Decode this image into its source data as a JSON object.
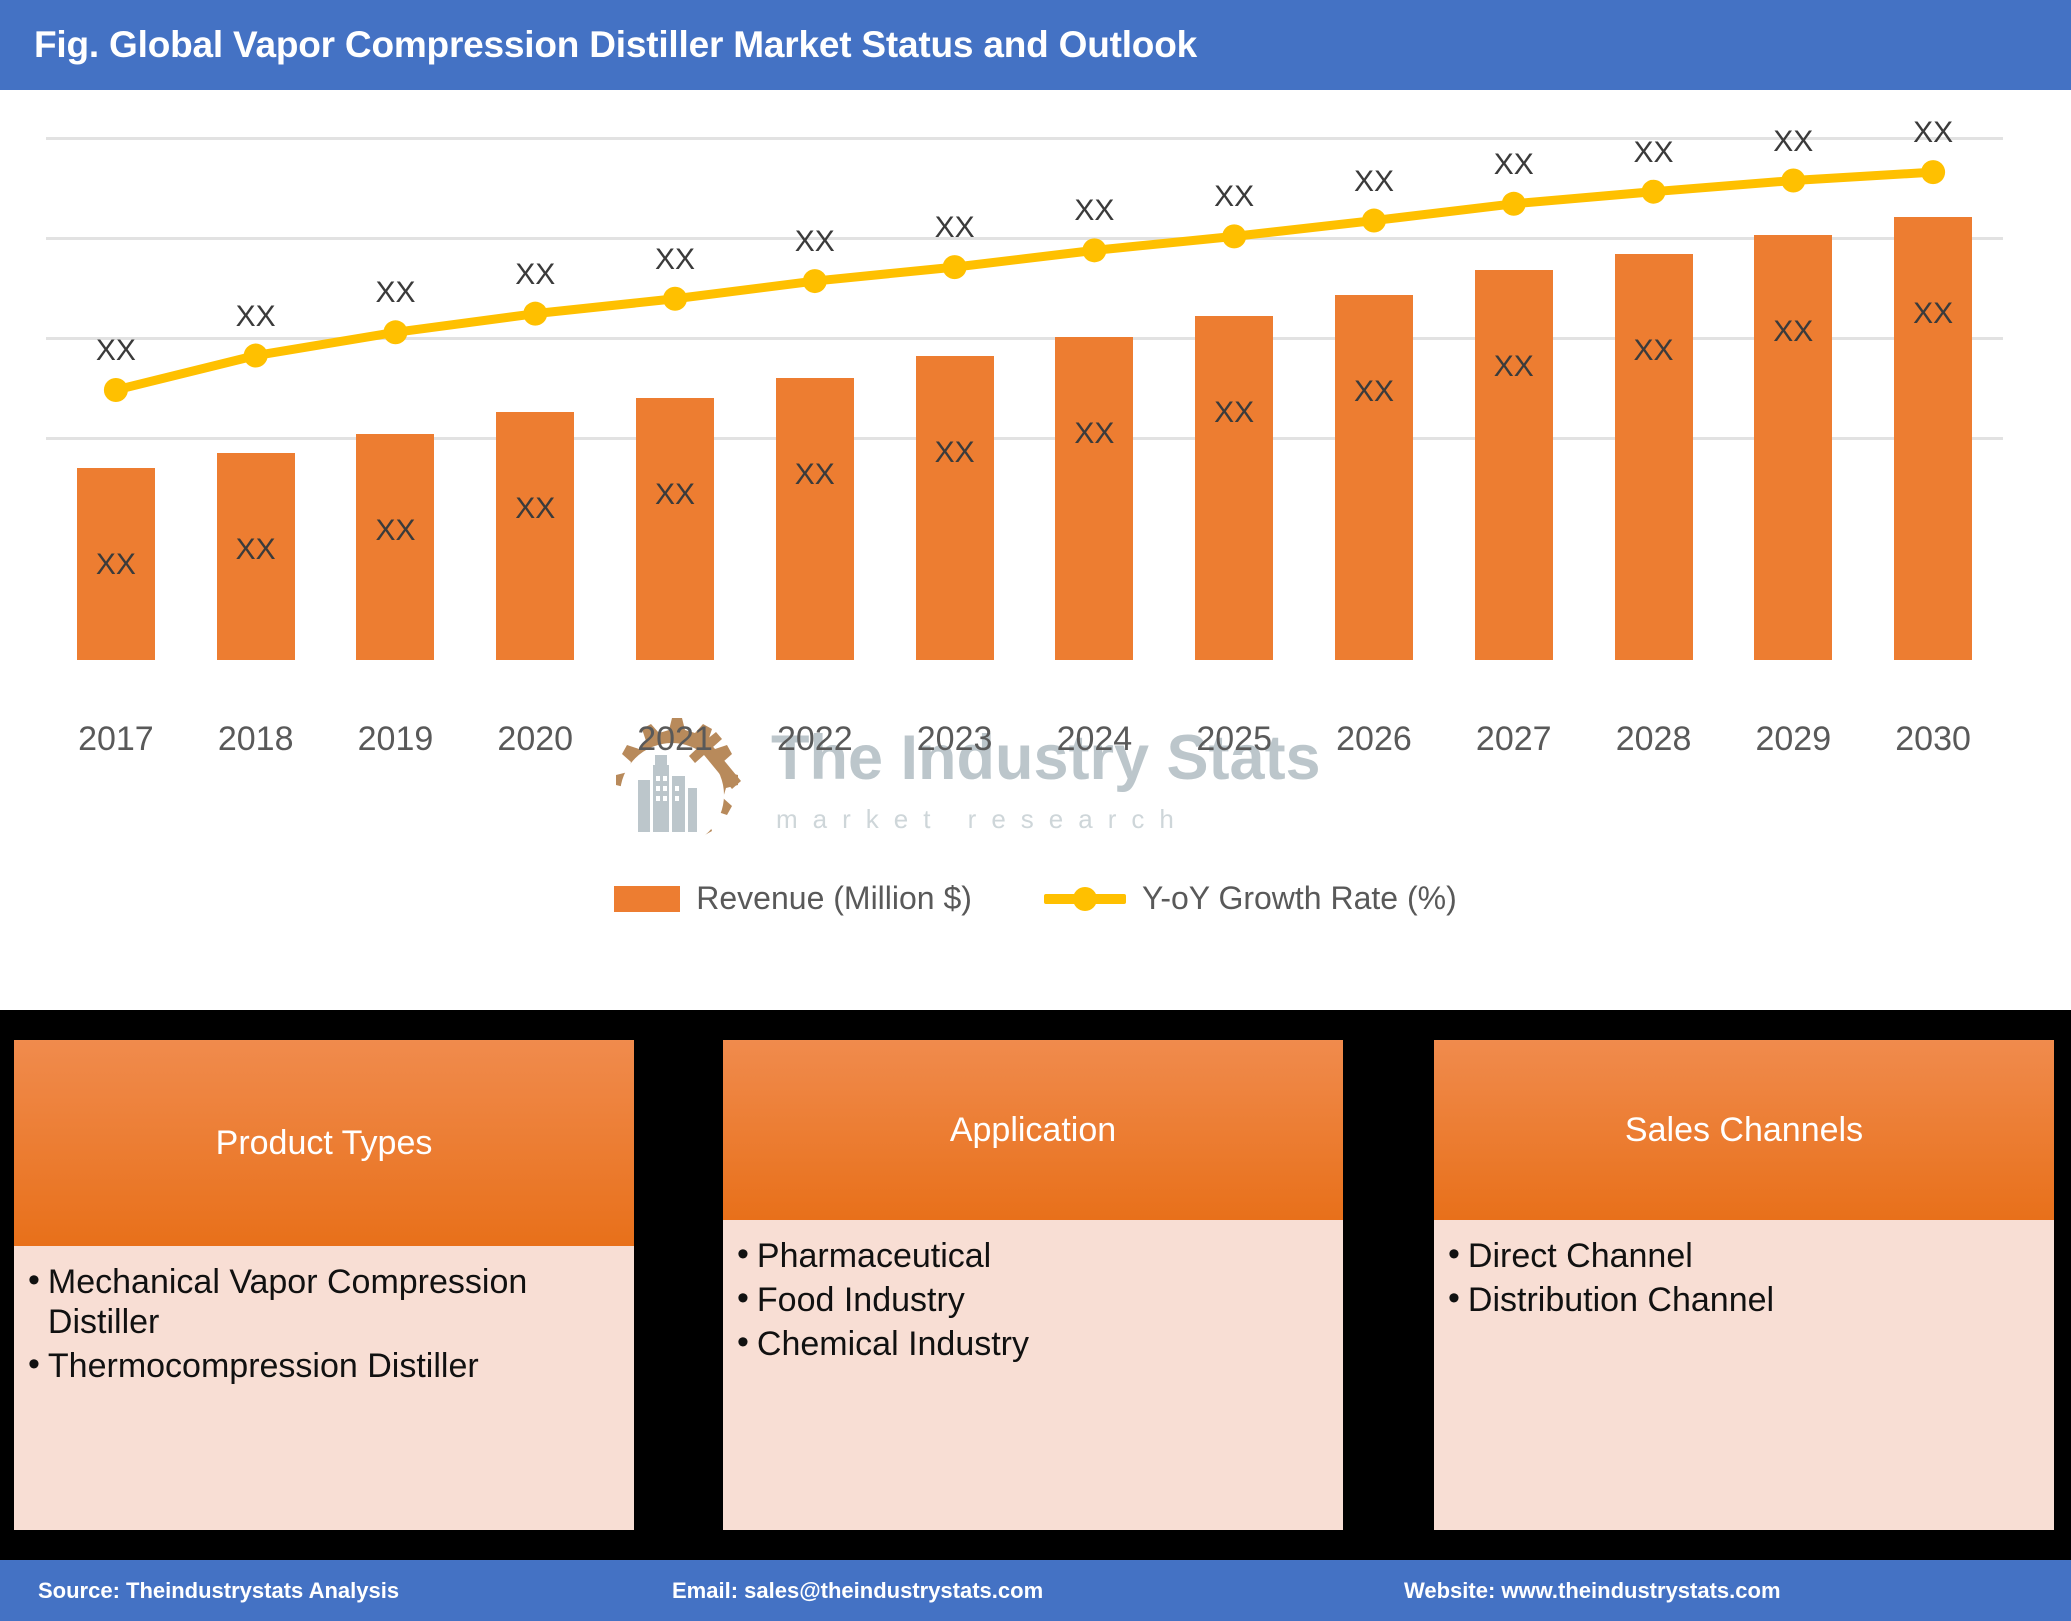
{
  "title": "Fig. Global Vapor Compression Distiller Market Status and Outlook",
  "colors": {
    "title_bar": "#4472C4",
    "bar_series": "#ED7D31",
    "line_series": "#FFC000",
    "box_header_top": "#F08B4D",
    "box_header_bottom": "#E8701A",
    "box_body": "#F8DED4",
    "band": "#000000",
    "gridline": "#e2e2e2"
  },
  "chart_data": {
    "type": "bar",
    "title": "Global Vapor Compression Distiller Market Status and Outlook",
    "xlabel": "",
    "ylabel": "",
    "grid": true,
    "legend_position": "bottom",
    "categories": [
      "2017",
      "2018",
      "2019",
      "2020",
      "2021",
      "2022",
      "2023",
      "2024",
      "2025",
      "2026",
      "2027",
      "2028",
      "2029",
      "2030"
    ],
    "series": [
      {
        "name": "Revenue (Million $)",
        "type": "bar",
        "color": "#ED7D31",
        "values": [
          206,
          222,
          243,
          266,
          281,
          303,
          327,
          347,
          370,
          392,
          419,
          436,
          457,
          476
        ],
        "value_labels": [
          "XX",
          "XX",
          "XX",
          "XX",
          "XX",
          "XX",
          "XX",
          "XX",
          "XX",
          "XX",
          "XX",
          "XX",
          "XX",
          "XX"
        ]
      },
      {
        "name": "Y-oY Growth Rate (%)",
        "type": "line",
        "color": "#FFC000",
        "values": [
          290,
          327,
          352,
          372,
          388,
          407,
          422,
          440,
          455,
          472,
          490,
          503,
          515,
          524
        ],
        "value_labels": [
          "XX",
          "XX",
          "XX",
          "XX",
          "XX",
          "XX",
          "XX",
          "XX",
          "XX",
          "XX",
          "XX",
          "XX",
          "XX",
          "XX"
        ]
      }
    ],
    "gridline_count": 4
  },
  "legend": [
    {
      "label": "Revenue (Million $)",
      "marker": "square-swatch"
    },
    {
      "label": "Y-oY Growth Rate (%)",
      "marker": "line-with-dot"
    }
  ],
  "watermark": {
    "text": "The Industry Stats",
    "subtext": "market research",
    "logo": "gear-factory-logo"
  },
  "info_boxes": [
    {
      "header": "Product Types",
      "items": [
        "Mechanical Vapor Compression Distiller",
        "Thermocompression Distiller"
      ]
    },
    {
      "header": "Application",
      "items": [
        "Pharmaceutical",
        "Food Industry",
        "Chemical Industry"
      ]
    },
    {
      "header": "Sales Channels",
      "items": [
        "Direct Channel",
        "Distribution Channel"
      ]
    }
  ],
  "footer": {
    "source": "Source: Theindustrystats Analysis",
    "email": "Email: sales@theindustrystats.com",
    "website": "Website: www.theindustrystats.com"
  }
}
